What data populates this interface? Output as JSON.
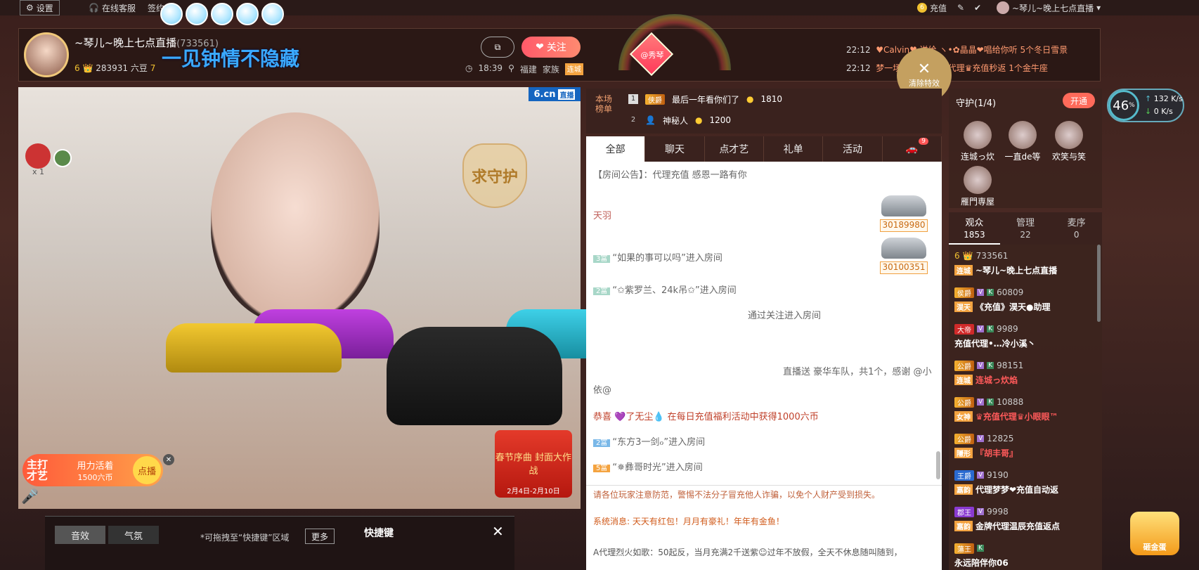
{
  "topbar": {
    "settings_label": "设置",
    "service_label": "在线客服",
    "sign_label": "签约",
    "recharge_label": "充值",
    "user_name": "~琴儿~晚上七点直播",
    "user_level": "6"
  },
  "host": {
    "name": "~琴儿~晚上七点直播",
    "room_id": "(733561)",
    "slogan": "一见钟情不隐藏",
    "level": "6",
    "beans": "283931 六豆",
    "level2": "7",
    "time": "18:39",
    "location": "福建",
    "family_label": "家族",
    "family_name": "连城",
    "follow_label": "关注",
    "xiuqin_label": "@秀琴"
  },
  "broadcast": [
    {
      "time": "22:12",
      "text": "♥Calvin♥ 送给 ヽ•✿晶晶❤唱给你听 5个冬日雪景"
    },
    {
      "time": "22:12",
      "text": "梦一场 送给 ♛艺琪代理♛充值秒返 1个金牛座"
    }
  ],
  "clear_fx_label": "清除特效",
  "video": {
    "brand": "6.cn",
    "live": "直播",
    "guard_text": "求守护",
    "talent_prefix": "主打才艺",
    "talent_name": "用力活着",
    "talent_price": "1500六币",
    "talent_button": "点播",
    "festival_title": "春节序曲 封面大作战",
    "festival_date": "2月4日-2月10日",
    "viewer_count": "x 1"
  },
  "quick_panel": {
    "tab1": "音效",
    "tab2": "气氛",
    "hint": "*可拖拽至“快捷键”区域",
    "more": "更多",
    "title": "快捷键"
  },
  "rank": {
    "label": "本场榜单",
    "rows": [
      {
        "num": "1",
        "badge": "侠爵",
        "name": "最后一年看你们了",
        "coins": "1810"
      },
      {
        "num": "2",
        "badge": "",
        "name": "神秘人",
        "coins": "1200"
      }
    ]
  },
  "chat_tabs": [
    "全部",
    "聊天",
    "点才艺",
    "礼单",
    "活动"
  ],
  "chat_tab_badge": "9",
  "chat": {
    "announce": "【房间公告】：代理充值 感恩一路有你",
    "m1_name": "天羽",
    "m1_car": "30189980",
    "m2_level": "3富",
    "m2": "“如果的事可以吗”进入房间",
    "m2_car": "30100351",
    "m3_level": "2富",
    "m3": "“✩紫罗兰、24k吊✩”进入房间",
    "m4": "通过关注进入房间",
    "m5": "直播送 豪华车队，共1个，感谢 @小",
    "m5b": "依@",
    "m6": "恭喜 💜了无尘💧 在每日充值福利活动中获得1000六币",
    "m7_level": "2富",
    "m7": "“东方3一剑ℴ”进入房间",
    "m8_level": "5富",
    "m8": "“✵彝哥时光”进入房间"
  },
  "notice": {
    "warn": "请各位玩家注意防范，警惕不法分子冒充他人诈骗，以免个人财产受到损失。",
    "sys": "系统消息: 天天有红包！月月有豪礼！年年有金鱼！",
    "ad": "A代理烈火如歌：50起反，当月充满2千送紫☺过年不放假，全天不休息随叫随到，"
  },
  "guard": {
    "title": "守护(1/4)",
    "open": "开通",
    "members": [
      "连城っ炊",
      "一直de等",
      "欢笑与笑",
      "雁門専屋"
    ]
  },
  "audience_tabs": [
    {
      "label": "观众",
      "count": "1853"
    },
    {
      "label": "管理",
      "count": "22"
    },
    {
      "label": "麦序",
      "count": "0"
    }
  ],
  "audience": [
    {
      "badge": "6",
      "id": "733561",
      "name": "~琴儿~晚上七点直播",
      "fam": "连城"
    },
    {
      "badge": "侯爵",
      "id": "60809",
      "name": "《充值》淏天●助理",
      "fam": "淏天"
    },
    {
      "badge": "大帝",
      "id": "9989",
      "name": "充值代理•…冷小溪丶",
      "fam": ""
    },
    {
      "badge": "公爵",
      "id": "98151",
      "name": "连城っ炊焰",
      "fam": "连城"
    },
    {
      "badge": "公爵",
      "id": "10888",
      "name": "♛充值代理♛小眼眼™",
      "fam": "女神"
    },
    {
      "badge": "公爵",
      "id": "12825",
      "name": "『胡丰哥』",
      "fam": "隱形"
    },
    {
      "badge": "王爵",
      "id": "9190",
      "name": "代理梦梦❤充值自动返",
      "fam": "嘉韵"
    },
    {
      "badge": "郡王",
      "id": "9998",
      "name": "金牌代理温辰充值返点",
      "fam": "嘉韵"
    },
    {
      "badge": "藩王",
      "id": "",
      "name": "永远陪伴你06",
      "fam": ""
    }
  ],
  "speed": {
    "pct": "46",
    "up": "132",
    "down": "0",
    "unit": "K/s"
  },
  "egg_label": "砸金蛋"
}
